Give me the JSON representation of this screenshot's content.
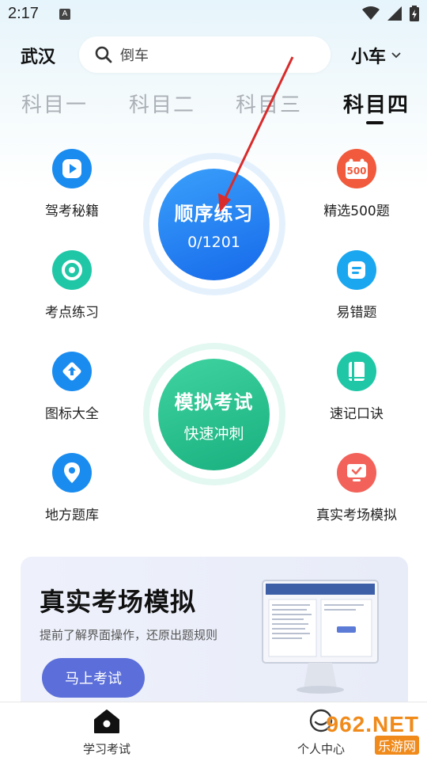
{
  "status": {
    "time": "2:17",
    "notif": "A"
  },
  "header": {
    "city": "武汉",
    "search_placeholder": "倒车",
    "car_type": "小车"
  },
  "tabs": [
    {
      "label": "科目一"
    },
    {
      "label": "科目二"
    },
    {
      "label": "科目三"
    },
    {
      "label": "科目四"
    }
  ],
  "active_tab": "科目四",
  "left_items": [
    {
      "label": "驾考秘籍",
      "color": "#1a8cf0"
    },
    {
      "label": "考点练习",
      "color": "#1fc7a6"
    },
    {
      "label": "图标大全",
      "color": "#1a8cf0"
    },
    {
      "label": "地方题库",
      "color": "#1a8cf0"
    }
  ],
  "right_items": [
    {
      "label": "精选500题",
      "color": "#f15a3c",
      "badge": "500"
    },
    {
      "label": "易错题",
      "color": "#1aa7f0"
    },
    {
      "label": "速记口诀",
      "color": "#1fc7a6"
    },
    {
      "label": "真实考场模拟",
      "color": "#f2625a"
    }
  ],
  "practice": {
    "title": "顺序练习",
    "progress": "0/1201",
    "color": "#1f84f0"
  },
  "mock": {
    "title": "模拟考试",
    "subtitle": "快速冲刺",
    "color": "#22c490"
  },
  "banner": {
    "title": "真实考场模拟",
    "subtitle": "提前了解界面操作，还原出题规则",
    "button": "马上考试"
  },
  "bottom_nav": [
    {
      "label": "学习考试"
    },
    {
      "label": "个人中心"
    }
  ],
  "watermark": {
    "brand": "962.NET",
    "site": "乐游网"
  }
}
